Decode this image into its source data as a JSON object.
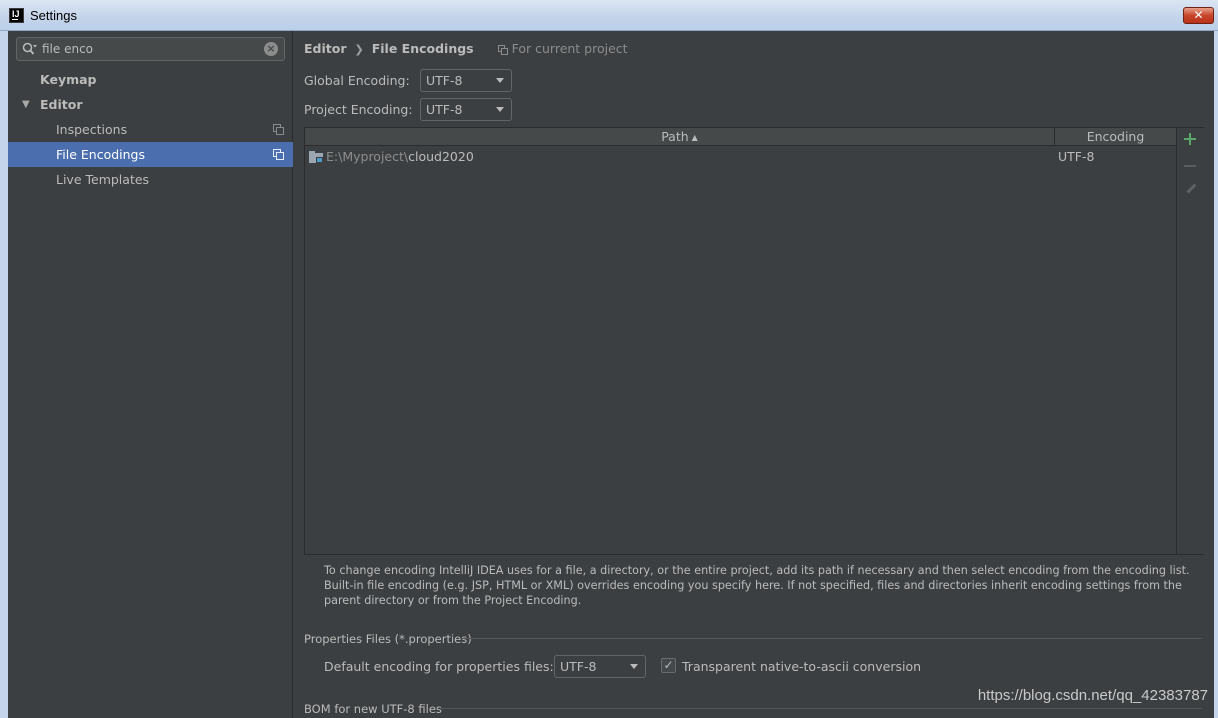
{
  "window": {
    "app_icon": "IJ",
    "title": "Settings",
    "close_label": "✕"
  },
  "sidebar": {
    "search": {
      "value": "file enco",
      "placeholder": ""
    },
    "items": [
      {
        "label": "Keymap",
        "level": 0,
        "bold": true
      },
      {
        "label": "Editor",
        "level": 0,
        "bold": true,
        "expanded": true
      },
      {
        "label": "Inspections",
        "level": 1,
        "project_scoped": true
      },
      {
        "label": "File Encodings",
        "level": 1,
        "selected": true,
        "project_scoped": true
      },
      {
        "label": "Live Templates",
        "level": 1
      }
    ]
  },
  "breadcrumb": {
    "parent": "Editor",
    "current": "File Encodings",
    "scope": "For current project"
  },
  "global_encoding": {
    "label": "Global Encoding:",
    "value": "UTF-8"
  },
  "project_encoding": {
    "label": "Project Encoding:",
    "value": "UTF-8"
  },
  "table": {
    "columns": {
      "path": "Path",
      "path_sort": "▲",
      "encoding": "Encoding"
    },
    "rows": [
      {
        "path_prefix": "E:\\Myproject\\",
        "path_name": "cloud2020",
        "encoding": "UTF-8"
      }
    ]
  },
  "info": "To change encoding IntelliJ IDEA uses for a file, a directory, or the entire project, add its path if necessary and then select encoding from the encoding list. Built-in file encoding (e.g. JSP, HTML or XML) overrides encoding you specify here. If not specified, files and directories inherit encoding settings from the parent directory or from the Project Encoding.",
  "properties": {
    "section_title": "Properties Files (*.properties)",
    "default_label": "Default encoding for properties files:",
    "default_value": "UTF-8",
    "transparent_label": "Transparent native-to-ascii conversion",
    "transparent_checked": true,
    "check_glyph": "✓"
  },
  "bom": {
    "section_title": "BOM for new UTF-8 files"
  },
  "watermark": "https://blog.csdn.net/qq_42383787",
  "colors": {
    "background": "#3c3f41",
    "selection": "#4b6eaf",
    "add_icon": "#59a869"
  }
}
